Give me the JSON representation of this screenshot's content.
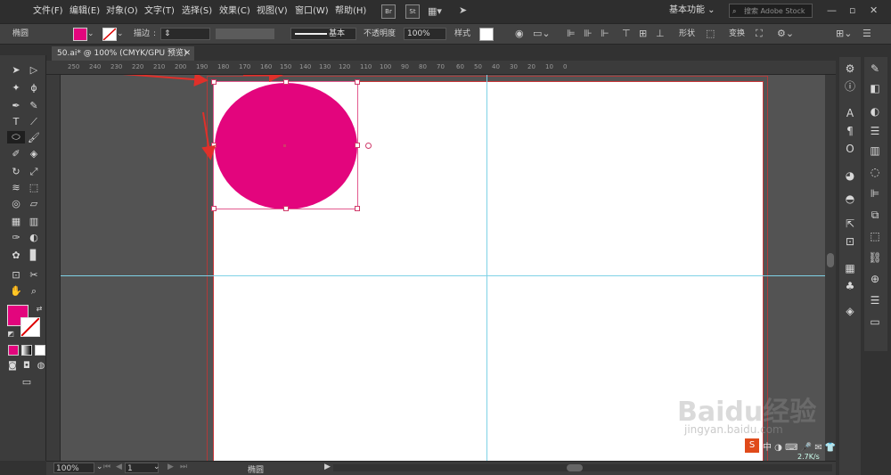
{
  "menu": [
    "文件(F)",
    "编辑(E)",
    "对象(O)",
    "文字(T)",
    "选择(S)",
    "效果(C)",
    "视图(V)",
    "窗口(W)",
    "帮助(H)"
  ],
  "app_buttons": [
    "Br",
    "St"
  ],
  "workspace_label": "基本功能",
  "stock_placeholder": "搜索 Adobe Stock",
  "control": {
    "object_type": "椭圆",
    "stroke_label": "描边",
    "stroke_profile": "基本",
    "opacity_label": "不透明度",
    "opacity_value": "100%",
    "style_label": "样式",
    "shape_label": "形状",
    "transform_label": "变换"
  },
  "doc_tab": "50.ai* @ 100% (CMYK/GPU 预览)",
  "ruler_h": [
    "250",
    "240",
    "230",
    "220",
    "210",
    "200",
    "190",
    "180",
    "170",
    "160",
    "150",
    "140",
    "130",
    "120",
    "110",
    "100",
    "90",
    "80",
    "70",
    "60",
    "50",
    "40",
    "30",
    "20",
    "10",
    "0"
  ],
  "status": {
    "zoom": "100%",
    "page": "1",
    "tool_name": "椭圆"
  },
  "net_speed": "2.7K/s",
  "badge_number": "74",
  "watermark": "Baidu经验",
  "watermark_sub": "jingyan.baidu.com",
  "colors": {
    "fill": "#e3057d",
    "guide": "#7fd2e6",
    "artboard_border": "#c8373a",
    "arrow": "#e0302a"
  },
  "icons": {
    "selection": "selection-tool-icon",
    "direct_selection": "direct-selection-tool-icon",
    "ellipse": "ellipse-tool-icon",
    "hand": "hand-tool-icon",
    "zoom": "zoom-tool-icon"
  }
}
